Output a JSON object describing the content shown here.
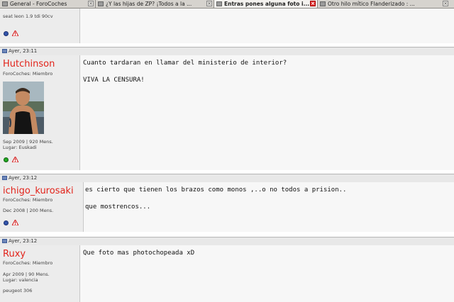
{
  "tabs": [
    {
      "label": "General - ForoCoches",
      "active": false
    },
    {
      "label": "¿Y las hijas de ZP? ¡Todos a la ...",
      "active": false
    },
    {
      "label": "Entras pones alguna foto i...",
      "active": true
    },
    {
      "label": "Otro hilo mítico Flanderizado : ...",
      "active": false
    }
  ],
  "posts": [
    {
      "signature": "seat leon 1.9 tdi 90cv",
      "status": "offline"
    },
    {
      "date": "Ayer, 23:11",
      "username": "Hutchinson",
      "rank": "ForoCoches: Miembro",
      "joined": "Sep 2009 | 920 Mens.",
      "location": "Lugar: Euskadi",
      "status": "online",
      "lines": [
        "Cuanto tardaran en llamar del ministerio de interior?",
        "VIVA LA CENSURA!"
      ]
    },
    {
      "date": "Ayer, 23:12",
      "username": "ichigo_kurosaki",
      "rank": "ForoCoches: Miembro",
      "joined": "Dec 2008 | 200 Mens.",
      "status": "offline",
      "lines": [
        "es cierto que tienen los brazos como monos ,..o no todos a prision..",
        "que mostrencos..."
      ]
    },
    {
      "date": "Ayer, 23:12",
      "username": "Ruxy",
      "rank": "ForoCoches: Miembro",
      "joined": "Apr 2009 | 90 Mens.",
      "location": "Lugar: valencia",
      "signature": "peugeot 306",
      "lines": [
        "Que foto mas photochopeada xD"
      ]
    }
  ],
  "colors": {
    "username": "#e2231a",
    "online": "#22aa22",
    "offline": "#3355aa"
  }
}
